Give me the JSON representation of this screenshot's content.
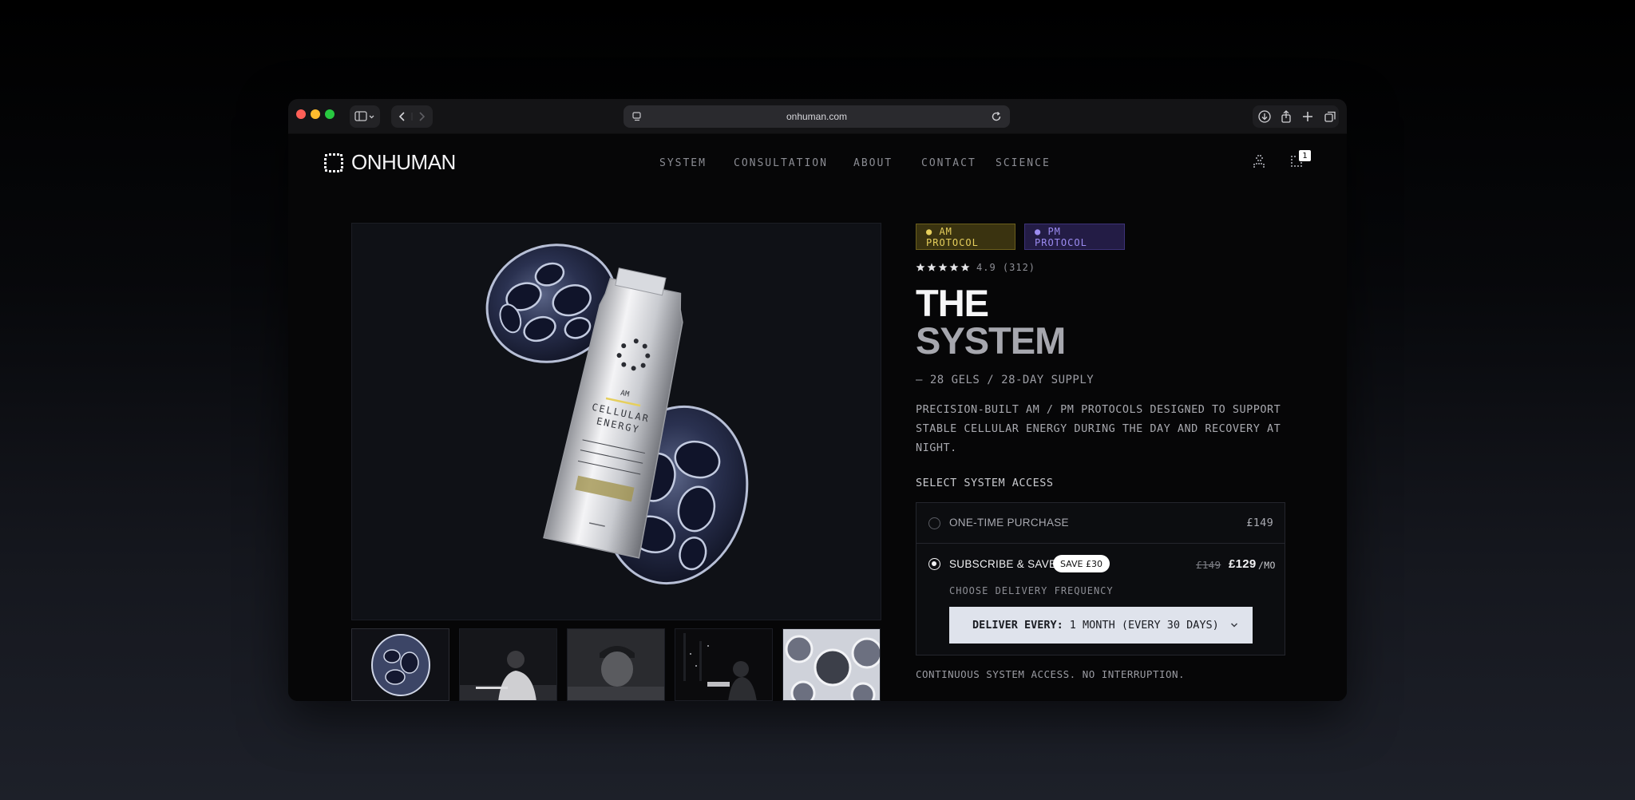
{
  "browser": {
    "url": "onhuman.com"
  },
  "header": {
    "logo_text": "ONHUMAN",
    "nav": [
      "SYSTEM",
      "CONSULTATION",
      "ABOUT",
      "CONTACT",
      "SCIENCE"
    ],
    "cart_count": "1"
  },
  "product": {
    "badges": [
      "● AM PROTOCOL",
      "● PM PROTOCOL"
    ],
    "rating_text": "4.9 (312)",
    "rating_stars": 5,
    "title_line1": "THE",
    "title_line2": "SYSTEM",
    "supply": "— 28 GELS / 28-DAY SUPPLY",
    "description": "PRECISION-BUILT AM / PM PROTOCOLS DESIGNED TO SUPPORT STABLE CELLULAR ENERGY DURING THE DAY AND RECOVERY AT NIGHT.",
    "select_label": "SELECT SYSTEM ACCESS",
    "options": {
      "one_time_label": "ONE-TIME PURCHASE",
      "one_time_price": "£149",
      "subscribe_label": "SUBSCRIBE & SAVE",
      "save_badge": "SAVE £30",
      "old_price": "£149",
      "new_price": "£129",
      "per": "/MO",
      "frequency_label": "CHOOSE DELIVERY FREQUENCY",
      "deliver_prefix": "DELIVER EVERY:",
      "deliver_value": "1 MONTH (EVERY 30 DAYS)"
    },
    "continuous_note": "CONTINUOUS SYSTEM ACCESS. NO INTERRUPTION.",
    "packaging": {
      "am": "AM",
      "line1": "CELLULAR",
      "line2": "ENERGY"
    }
  },
  "colors": {
    "am_accent": "#e6cf5c",
    "pm_accent": "#9c8cf2",
    "background": "#060607"
  }
}
